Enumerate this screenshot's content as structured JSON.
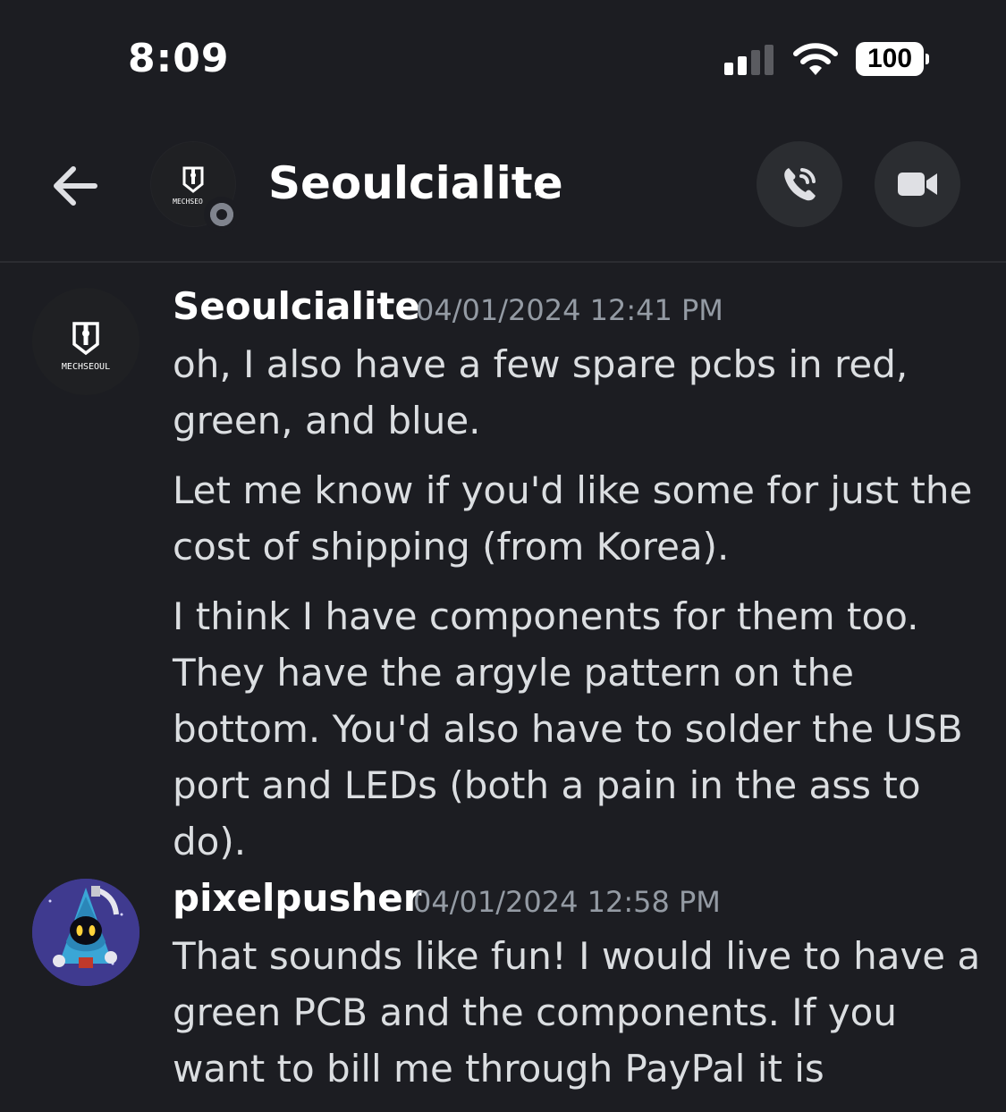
{
  "status_bar": {
    "time": "8:09",
    "battery": "100"
  },
  "header": {
    "title": "Seoulcialite",
    "chevron": "›",
    "avatar_text": "MECHSEO",
    "icons": [
      "back-arrow-icon",
      "phone-call-icon",
      "video-camera-icon"
    ]
  },
  "messages": [
    {
      "username": "Seoulcialite",
      "timestamp": "04/01/2024 12:41 PM",
      "avatar_text": "MECHSEOUL",
      "paragraphs": [
        "oh, I also have a few spare pcbs in red, green, and blue.",
        "Let me know if you'd like some for just the cost of shipping (from Korea).",
        "I think I have components for them too. They have the argyle pattern on the bottom. You'd also have to solder the USB port and LEDs (both a pain in the ass to do)."
      ]
    },
    {
      "username": "pixelpusher",
      "timestamp": "04/01/2024 12:58 PM",
      "paragraphs": [
        "That sounds like fun! I would live to have a green PCB and the components.  If you want to bill me through PayPal it is"
      ]
    }
  ],
  "colors": {
    "background": "#1c1d22",
    "username": "#ffffff",
    "timestamp": "#949ba4",
    "text": "#dbdee1",
    "button_bg": "#2b2d31"
  }
}
